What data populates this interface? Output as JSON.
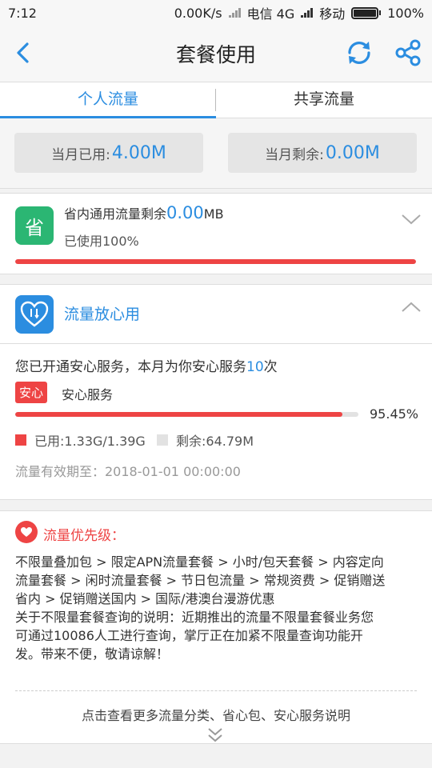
{
  "status_bar": {
    "time": "7:12",
    "speed": "0.00K/s",
    "carrier1": "电信 4G",
    "carrier2": "移动",
    "battery": "100%"
  },
  "header": {
    "title": "套餐使用"
  },
  "tabs": [
    {
      "label": "个人流量",
      "active": true
    },
    {
      "label": "共享流量",
      "active": false
    }
  ],
  "summary": {
    "used_label": "当月已用:",
    "used_value": "4.00M",
    "remaining_label": "当月剩余:",
    "remaining_value": "0.00M"
  },
  "province_card": {
    "icon_text": "省",
    "title_prefix": "省内通用流量剩余",
    "title_value": "0.00",
    "title_unit": "MB",
    "used_text": "已使用100%",
    "progress": 1.0
  },
  "reassurance_card": {
    "title": "流量放心用",
    "desc_prefix": "您已开通安心服务，本月为你安心服务",
    "desc_count": "10",
    "desc_suffix": "次",
    "tag": "安心",
    "service_name": "安心服务",
    "percent_text": "95.45%",
    "progress": 0.9545,
    "used_text": "已用:1.33G/1.39G",
    "remaining_text": "剩余:64.79M",
    "validity": "流量有效期至：2018-01-01 00:00:00"
  },
  "priority_card": {
    "title": "流量优先级：",
    "lines": [
      "不限量叠加包 > 限定APN流量套餐 > 小时/包天套餐 > 内容定向",
      "流量套餐 > 闲时流量套餐 > 节日包流量 > 常规资费 > 促销赠送",
      "省内 > 促销赠送国内 > 国际/港澳台漫游优惠",
      "关于不限量套餐查询的说明：近期推出的流量不限量套餐业务您",
      "可通过10086人工进行查询，掌厅正在加紧不限量查询功能开",
      "发。带来不便，敬请谅解！"
    ],
    "more_link": "点击查看更多流量分类、省心包、安心服务说明"
  },
  "colors": {
    "accent": "#2b8de0",
    "danger": "#ee4444",
    "green": "#2bb673"
  }
}
